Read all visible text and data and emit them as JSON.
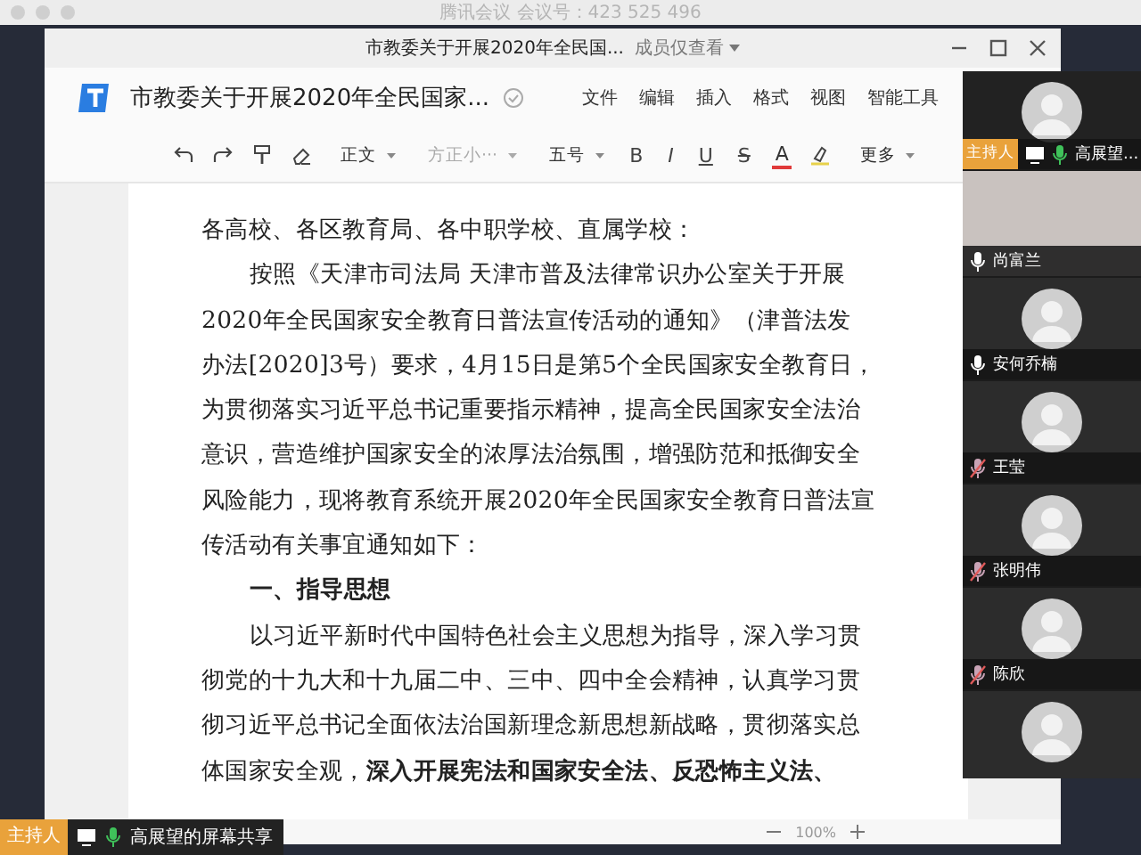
{
  "meeting_title": "腾讯会议 会议号：423 525 496",
  "window": {
    "title": "市教委关于开展2020年全民国...",
    "permission": "成员仅查看"
  },
  "app": {
    "doc_title": "市教委关于开展2020年全民国家...",
    "menus": [
      "文件",
      "编辑",
      "插入",
      "格式",
      "视图",
      "智能工具"
    ]
  },
  "toolbar": {
    "style": "正文",
    "font": "方正小···",
    "size": "五号",
    "format_buttons": [
      "B",
      "I",
      "U",
      "S",
      "A"
    ],
    "more": "更多"
  },
  "document": {
    "lines": [
      {
        "kind": "plain",
        "text": "各高校、各区教育局、各中职学校、直属学校："
      },
      {
        "kind": "indent",
        "text": "按照《天津市司法局 天津市普及法律常识办公室关于开展"
      },
      {
        "kind": "plain",
        "text": "2020年全民国家安全教育日普法宣传活动的通知》（津普法发"
      },
      {
        "kind": "plain",
        "text": "办法[2020]3号）要求，4月15日是第5个全民国家安全教育日，"
      },
      {
        "kind": "plain",
        "text": "为贯彻落实习近平总书记重要指示精神，提高全民国家安全法治"
      },
      {
        "kind": "plain",
        "text": "意识，营造维护国家安全的浓厚法治氛围，增强防范和抵御安全"
      },
      {
        "kind": "plain",
        "text": "风险能力，现将教育系统开展2020年全民国家安全教育日普法宣"
      },
      {
        "kind": "plain",
        "text": "传活动有关事宜通知如下："
      },
      {
        "kind": "heading",
        "text": "一、指导思想"
      },
      {
        "kind": "indent",
        "text": "以习近平新时代中国特色社会主义思想为指导，深入学习贯"
      },
      {
        "kind": "plain",
        "text": "彻党的十九大和十九届二中、三中、四中全会精神，认真学习贯"
      },
      {
        "kind": "plain",
        "text": "彻习近平总书记全面依法治国新理念新思想新战略，贯彻落实总"
      },
      {
        "kind": "plain",
        "text": "体国家安全观，**深入开展宪法和国家安全法、反恐怖主义法、**"
      }
    ]
  },
  "zoom": "100%",
  "participants": [
    {
      "kind": "host",
      "role": "主持人",
      "name": "高展望...",
      "muted": false
    },
    {
      "kind": "video",
      "name": "尚富兰",
      "muted": false
    },
    {
      "kind": "avatar",
      "name": "安何乔楠",
      "muted": false
    },
    {
      "kind": "avatar",
      "name": "王莹",
      "muted": true
    },
    {
      "kind": "avatar",
      "name": "张明伟",
      "muted": true
    },
    {
      "kind": "avatar",
      "name": "陈欣",
      "muted": true
    },
    {
      "kind": "partial"
    }
  ],
  "share_bar": {
    "role": "主持人",
    "label": "高展望的屏幕共享",
    "muted": false
  }
}
